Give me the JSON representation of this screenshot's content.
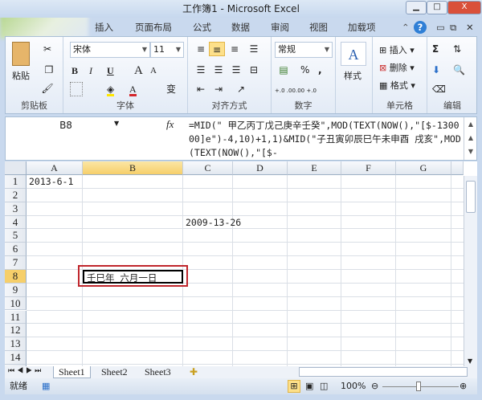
{
  "window": {
    "title": "工作簿1 - Microsoft Excel",
    "minimize": "▁",
    "maximize": "□",
    "close": "X"
  },
  "ribbon_tabs": [
    "插入",
    "页面布局",
    "公式",
    "数据",
    "审阅",
    "视图",
    "加载项"
  ],
  "groups": {
    "clipboard": {
      "label": "剪贴板",
      "paste": "粘贴"
    },
    "font": {
      "label": "字体",
      "font_name": "宋体",
      "font_size": "11",
      "bold": "B",
      "italic": "I",
      "underline": "U",
      "grow": "A",
      "shrink": "A",
      "font_color": "A",
      "phonetic": "变"
    },
    "alignment": {
      "label": "对齐方式"
    },
    "number": {
      "label": "数字",
      "format": "常规",
      "percent": "%",
      "comma": ",",
      "inc_dec": "+.0 .00",
      "dec_dec": ".00 +.0"
    },
    "styles": {
      "label": "样式",
      "button": "样式"
    },
    "cells": {
      "label": "单元格",
      "insert": "插入",
      "delete": "删除",
      "format": "格式"
    },
    "editing": {
      "label": "编辑",
      "sum": "Σ"
    }
  },
  "formula_bar": {
    "name_box": "B8",
    "fx": "fx",
    "formula": "=MID(\" 甲乙丙丁戊己庚辛壬癸\",MOD(TEXT(NOW(),\"[$-130000]e\")-4,10)+1,1)&MID(\"子丑寅卯辰巳午未申酉 戌亥\",MOD(TEXT(NOW(),\"[$-"
  },
  "grid": {
    "columns": [
      "A",
      "B",
      "C",
      "D",
      "E",
      "F",
      "G"
    ],
    "selected_column": "B",
    "selected_row": 8,
    "rows": [
      1,
      2,
      3,
      4,
      5,
      6,
      7,
      8,
      9,
      10,
      11,
      12,
      13,
      14
    ],
    "cells": [
      {
        "ref": "A1",
        "value": "2013-6-1"
      },
      {
        "ref": "C4",
        "value": "2009-13-26"
      },
      {
        "ref": "B8",
        "value": "壬巳年 六月一日"
      }
    ],
    "highlight_color": "#c0262c"
  },
  "sheet_tabs": [
    "Sheet1",
    "Sheet2",
    "Sheet3"
  ],
  "status": {
    "ready": "就绪",
    "zoom": "100%"
  }
}
